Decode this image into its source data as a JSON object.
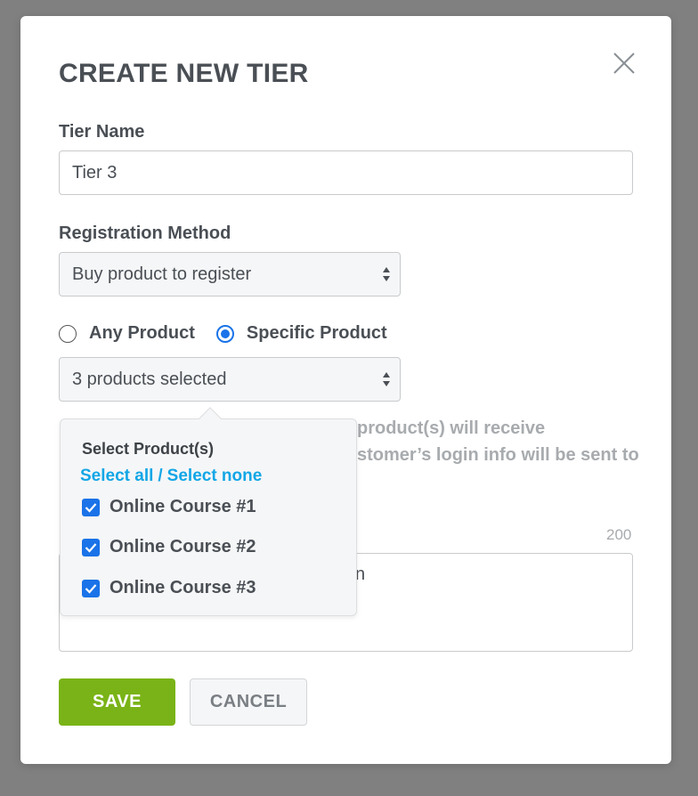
{
  "modal": {
    "title": "CREATE NEW TIER",
    "close_icon": "close-icon"
  },
  "tier_name": {
    "label": "Tier Name",
    "value": "Tier 3"
  },
  "registration_method": {
    "label": "Registration Method",
    "selected": "Buy product to register"
  },
  "product_scope": {
    "options": [
      {
        "label": "Any Product",
        "checked": false
      },
      {
        "label": "Specific Product",
        "checked": true
      }
    ]
  },
  "product_select": {
    "selected": "3 products selected"
  },
  "helper_text": {
    "line1": "product(s) will receive",
    "line2": "stomer’s login info will be sent to"
  },
  "description": {
    "char_count": "200",
    "visible_text": "n"
  },
  "popover": {
    "title": "Select Product(s)",
    "select_all": "Select all",
    "separator": "/",
    "select_none": "Select none",
    "items": [
      {
        "label": "Online Course #1",
        "checked": true
      },
      {
        "label": "Online Course #2",
        "checked": true
      },
      {
        "label": "Online Course #3",
        "checked": true
      }
    ]
  },
  "buttons": {
    "save": "SAVE",
    "cancel": "CANCEL"
  },
  "colors": {
    "overlay": "#808080",
    "accent_green": "#7ab317",
    "link_blue": "#12a6e6",
    "checkbox_blue": "#1a73e8"
  }
}
